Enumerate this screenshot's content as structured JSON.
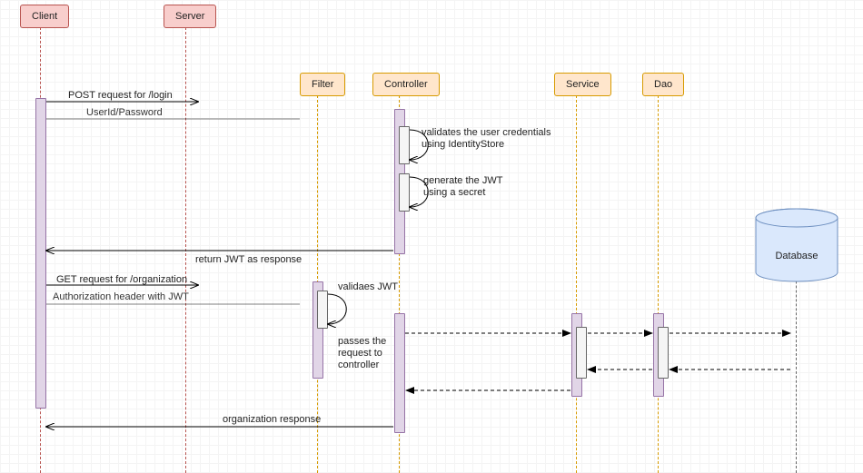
{
  "participants": {
    "client": "Client",
    "server": "Server",
    "filter": "Filter",
    "controller": "Controller",
    "service": "Service",
    "dao": "Dao",
    "database": "Database"
  },
  "messages": {
    "m1": "POST request for /login",
    "m1sub": "UserId/Password",
    "self1a": "validates the user credentials",
    "self1b": "using IdentityStore",
    "self2a": "generate the JWT",
    "self2b": "using a secret",
    "ret1": "return JWT as response",
    "m2": "GET request for /organization",
    "m2sub": "Authorization header with JWT",
    "filt1": "validaes JWT",
    "filt2a": "passes the",
    "filt2b": "request to",
    "filt2c": "controller",
    "ret2": "organization response"
  },
  "colors": {
    "actorFill": "#f8cecc",
    "lifeFill": "#ffe6cc",
    "barFill": "#e1d5e7",
    "dbFill": "#dae8fc",
    "dbStroke": "#6c8ebf"
  }
}
